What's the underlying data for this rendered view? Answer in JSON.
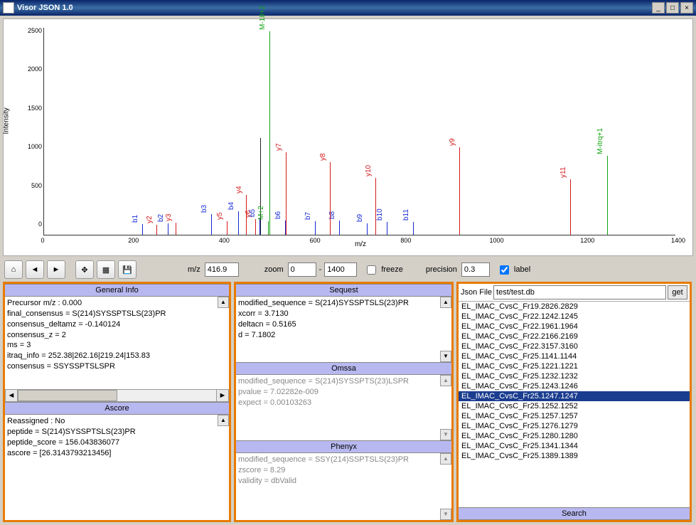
{
  "window": {
    "title": "Visor JSON 1.0"
  },
  "chart_data": {
    "type": "bar",
    "xlabel": "m/z",
    "ylabel": "Intensity",
    "xlim": [
      0,
      1400
    ],
    "ylim": [
      0,
      2700
    ],
    "xticks": [
      0,
      200,
      400,
      600,
      800,
      1000,
      1200,
      1400
    ],
    "yticks": [
      0,
      500,
      1000,
      1500,
      2000,
      2500
    ],
    "peaks": [
      {
        "mz": 218,
        "int": 140,
        "label": "b1",
        "color": "blue"
      },
      {
        "mz": 249,
        "int": 130,
        "label": "y2",
        "color": "red"
      },
      {
        "mz": 274,
        "int": 150,
        "label": "b2",
        "color": "blue"
      },
      {
        "mz": 291,
        "int": 160,
        "label": "y3",
        "color": "red"
      },
      {
        "mz": 371,
        "int": 270,
        "label": "b3",
        "color": "blue"
      },
      {
        "mz": 405,
        "int": 180,
        "label": "y5",
        "color": "red"
      },
      {
        "mz": 430,
        "int": 310,
        "label": "b4",
        "color": "blue"
      },
      {
        "mz": 447,
        "int": 520,
        "label": "y4",
        "color": "red"
      },
      {
        "mz": 468,
        "int": 200,
        "label": "y6",
        "color": "red"
      },
      {
        "mz": 477,
        "int": 210,
        "label": "b5",
        "color": "blue"
      },
      {
        "mz": 480,
        "int": 1260,
        "label": "",
        "color": "black"
      },
      {
        "mz": 497,
        "int": 180,
        "label": "M+2",
        "color": "green"
      },
      {
        "mz": 499,
        "int": 2650,
        "label": "M-18+2",
        "color": "green"
      },
      {
        "mz": 534,
        "int": 190,
        "label": "b6",
        "color": "blue"
      },
      {
        "mz": 536,
        "int": 1080,
        "label": "y7",
        "color": "red"
      },
      {
        "mz": 600,
        "int": 180,
        "label": "b7",
        "color": "blue"
      },
      {
        "mz": 655,
        "int": 190,
        "label": "b8",
        "color": "blue"
      },
      {
        "mz": 716,
        "int": 150,
        "label": "b9",
        "color": "blue"
      },
      {
        "mz": 634,
        "int": 950,
        "label": "y8",
        "color": "red"
      },
      {
        "mz": 735,
        "int": 740,
        "label": "y10",
        "color": "red"
      },
      {
        "mz": 760,
        "int": 170,
        "label": "b10",
        "color": "blue"
      },
      {
        "mz": 818,
        "int": 170,
        "label": "b11",
        "color": "blue"
      },
      {
        "mz": 920,
        "int": 1140,
        "label": "y9",
        "color": "red"
      },
      {
        "mz": 1166,
        "int": 720,
        "label": "y11",
        "color": "red"
      },
      {
        "mz": 1248,
        "int": 1030,
        "label": "M-itrq+1",
        "color": "green"
      }
    ]
  },
  "toolbar": {
    "mz_label": "m/z",
    "mz_val": "416.9",
    "zoom_label": "zoom",
    "zoom_min": "0",
    "zoom_dash": "-",
    "zoom_max": "1400",
    "freeze_label": "freeze",
    "precision_label": "precision",
    "precision_val": "0.3",
    "annot_label": "label"
  },
  "general": {
    "head": "General Info",
    "lines": [
      "Precursor m/z : 0.000",
      "final_consensus = S(214)SYSSPTSLS(23)PR",
      "consensus_deltamz = -0.140124",
      "consensus_z = 2",
      "ms = 3",
      "itraq_info = 252.38|262.16|219.24|153.83",
      "consensus = SSYSSPTSLSPR"
    ]
  },
  "ascore": {
    "head": "Ascore",
    "lines": [
      "Reassigned : No",
      "peptide = S(214)SYSSPTSLS(23)PR",
      "peptide_score = 156.043836077",
      "ascore = [26.3143793213456]"
    ]
  },
  "sequest": {
    "head": "Sequest",
    "lines": [
      "modified_sequence = S(214)SYSSPTSLS(23)PR",
      "xcorr = 3.7130",
      "deltacn = 0.5165",
      "d = 7.1802"
    ]
  },
  "omssa": {
    "head": "Omssa",
    "lines": [
      "modified_sequence = S(214)SYSSPTS(23)LSPR",
      "pvalue = 7.02282e-009",
      "expect = 0.00103263"
    ]
  },
  "phenyx": {
    "head": "Phenyx",
    "lines": [
      "modified_sequence = SSY(214)SSPTSLS(23)PR",
      "zscore = 8.29",
      "validity = dbValid"
    ]
  },
  "json": {
    "file_label": "Json File",
    "file_value": "test/test.db",
    "get_label": "get",
    "search_head": "Search",
    "items": [
      "EL_IMAC_CvsC_Fr19.2826.2829",
      "EL_IMAC_CvsC_Fr22.1242.1245",
      "EL_IMAC_CvsC_Fr22.1961.1964",
      "EL_IMAC_CvsC_Fr22.2166.2169",
      "EL_IMAC_CvsC_Fr22.3157.3160",
      "EL_IMAC_CvsC_Fr25.1141.1144",
      "EL_IMAC_CvsC_Fr25.1221.1221",
      "EL_IMAC_CvsC_Fr25.1232.1232",
      "EL_IMAC_CvsC_Fr25.1243.1246",
      "EL_IMAC_CvsC_Fr25.1247.1247",
      "EL_IMAC_CvsC_Fr25.1252.1252",
      "EL_IMAC_CvsC_Fr25.1257.1257",
      "EL_IMAC_CvsC_Fr25.1276.1279",
      "EL_IMAC_CvsC_Fr25.1280.1280",
      "EL_IMAC_CvsC_Fr25.1341.1344",
      "EL_IMAC_CvsC_Fr25.1389.1389"
    ],
    "selected_index": 9
  }
}
